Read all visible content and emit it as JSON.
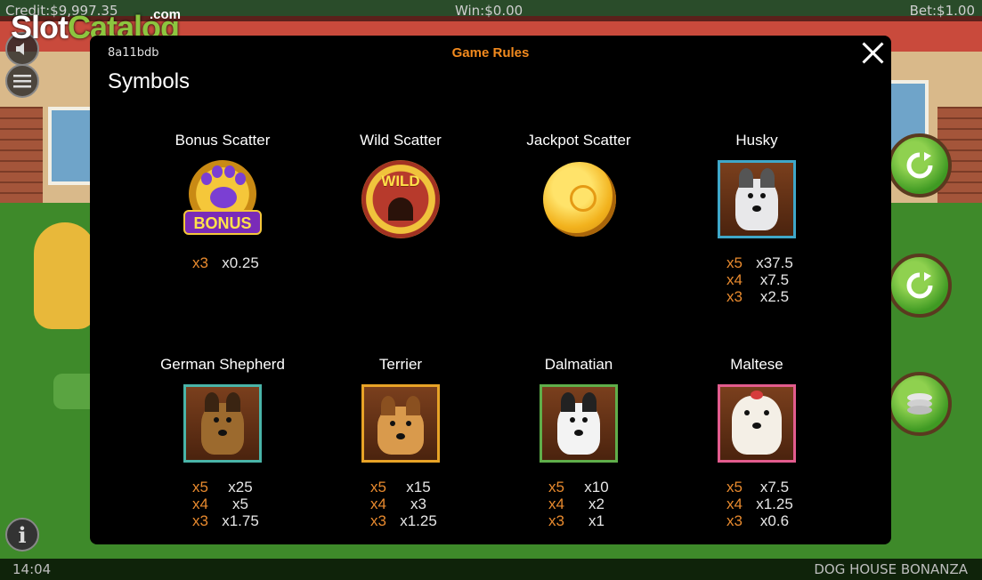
{
  "topbar": {
    "credit": "Credit:$9,997.35",
    "win": "Win:$0.00",
    "bet": "Bet:$1.00"
  },
  "bottombar": {
    "clock": "14:04",
    "game_name": "DOG HOUSE BONANZA"
  },
  "watermark": {
    "slot": "Slot",
    "catalog": "Catalog",
    "com": ".com"
  },
  "left_buttons": {
    "info_label": "i"
  },
  "modal": {
    "session_id": "8a11bdb",
    "title": "Game Rules",
    "section_title": "Symbols",
    "symbols": [
      {
        "name": "Bonus Scatter",
        "icon": "bonus-paw-icon",
        "bonus_text": "BONUS",
        "pays": [
          {
            "mult": "x3",
            "val": "x0.25"
          }
        ]
      },
      {
        "name": "Wild Scatter",
        "icon": "wild-doghouse-icon",
        "wild_text": "WILD",
        "pays": []
      },
      {
        "name": "Jackpot Scatter",
        "icon": "gold-coin-icon",
        "pays": []
      },
      {
        "name": "Husky",
        "icon": "husky-icon",
        "pays": [
          {
            "mult": "x5",
            "val": "x37.5"
          },
          {
            "mult": "x4",
            "val": "x7.5"
          },
          {
            "mult": "x3",
            "val": "x2.5"
          }
        ]
      },
      {
        "name": "German Shepherd",
        "icon": "german-shepherd-icon",
        "pays": [
          {
            "mult": "x5",
            "val": "x25"
          },
          {
            "mult": "x4",
            "val": "x5"
          },
          {
            "mult": "x3",
            "val": "x1.75"
          }
        ]
      },
      {
        "name": "Terrier",
        "icon": "terrier-icon",
        "pays": [
          {
            "mult": "x5",
            "val": "x15"
          },
          {
            "mult": "x4",
            "val": "x3"
          },
          {
            "mult": "x3",
            "val": "x1.25"
          }
        ]
      },
      {
        "name": "Dalmatian",
        "icon": "dalmatian-icon",
        "pays": [
          {
            "mult": "x5",
            "val": "x10"
          },
          {
            "mult": "x4",
            "val": "x2"
          },
          {
            "mult": "x3",
            "val": "x1"
          }
        ]
      },
      {
        "name": "Maltese",
        "icon": "maltese-icon",
        "pays": [
          {
            "mult": "x5",
            "val": "x7.5"
          },
          {
            "mult": "x4",
            "val": "x1.25"
          },
          {
            "mult": "x3",
            "val": "x0.6"
          }
        ]
      }
    ]
  },
  "colors": {
    "title_orange": "#f28a1e",
    "multiplier_orange": "#e88a2e",
    "modal_bg": "#000000"
  }
}
